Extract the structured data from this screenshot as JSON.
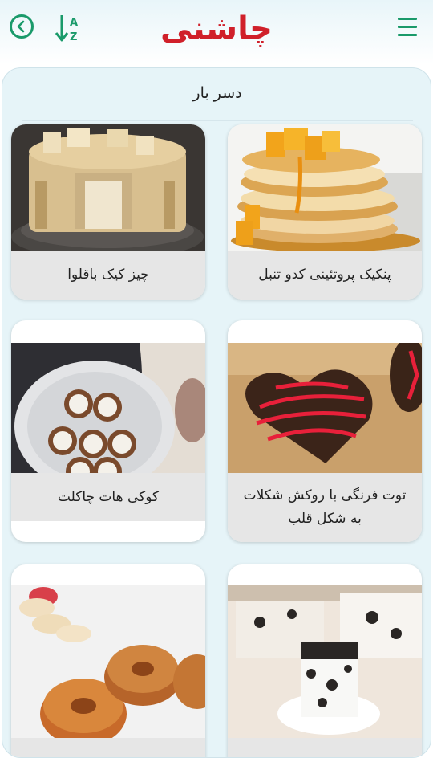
{
  "header": {
    "logo_text": "چاشنی",
    "back_icon": "chevron-left-circle-icon",
    "sort_icon": "sort-az-icon",
    "menu_icon": "hamburger-menu-icon",
    "accent_color": "#1a9a6a",
    "logo_color": "#d0202a"
  },
  "section": {
    "title": "دسر بار"
  },
  "recipes": [
    {
      "title": "پنکیک پروتئینی کدو تنبل"
    },
    {
      "title": "چیز کیک باقلوا"
    },
    {
      "title": "توت فرنگی با روکش شکلات به شکل قلب"
    },
    {
      "title": "کوکی هات چاکلت"
    },
    {
      "title": ""
    },
    {
      "title": ""
    }
  ]
}
